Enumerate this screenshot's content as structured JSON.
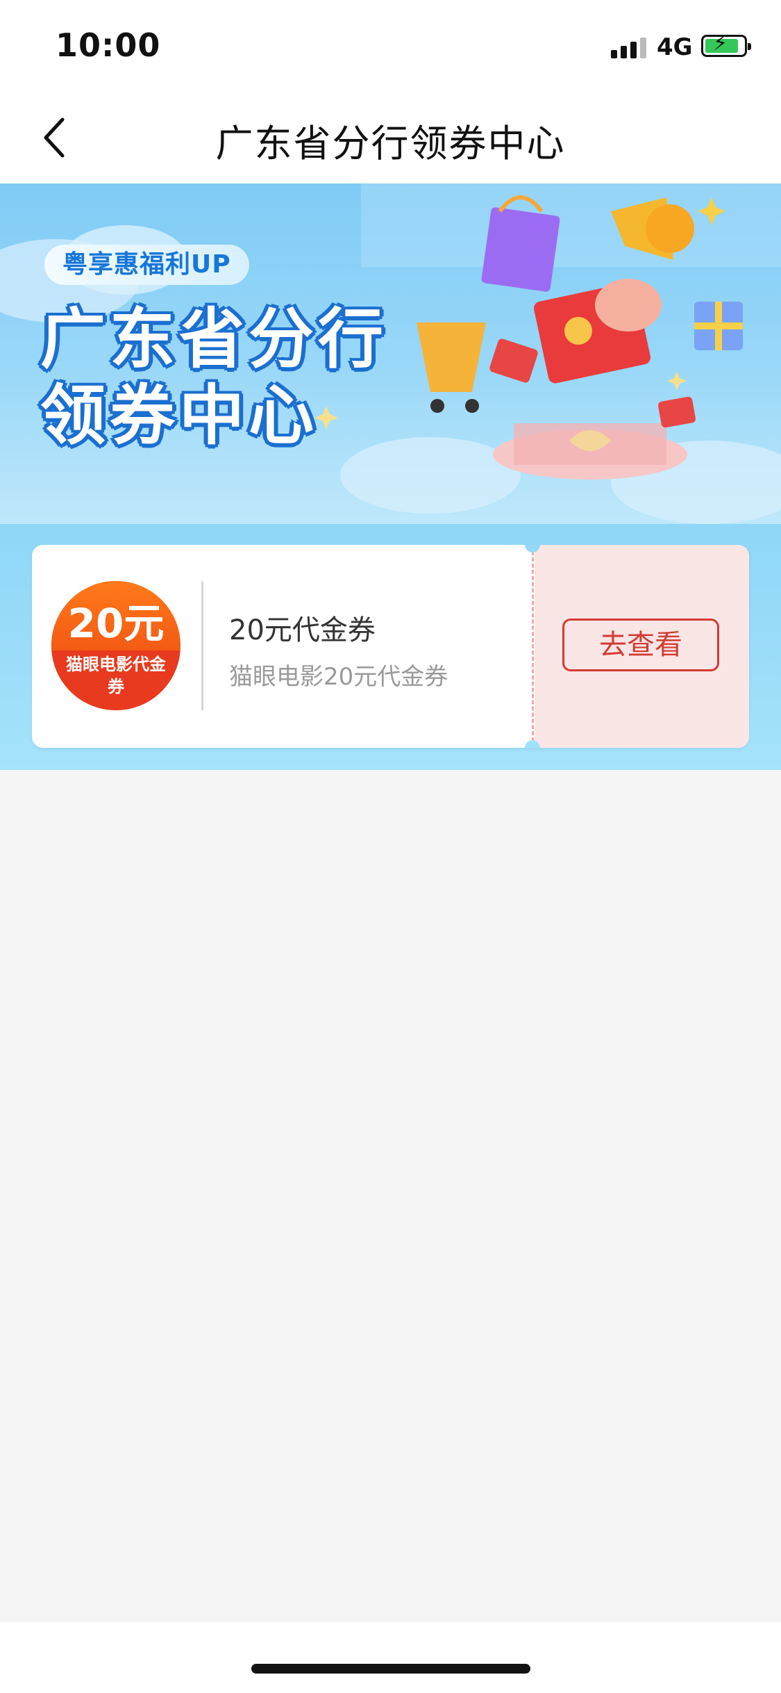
{
  "status_bar": {
    "time": "10:00",
    "network": "4G"
  },
  "nav": {
    "title": "广东省分行领券中心"
  },
  "banner": {
    "tag": "粤享惠福利UP",
    "title_line1": "广东省分行",
    "title_line2": "领券中心",
    "colors": {
      "sky": "#8fd6f7",
      "title_outline": "#1b6fd0"
    }
  },
  "coupon": {
    "badge_amount": "20元",
    "badge_label": "猫眼电影代金券",
    "title": "20元代金券",
    "subtitle": "猫眼电影20元代金券",
    "action_label": "去查看",
    "colors": {
      "badge": "#f45a14",
      "action": "#d33a32",
      "action_bg": "#fbe6e6"
    }
  }
}
